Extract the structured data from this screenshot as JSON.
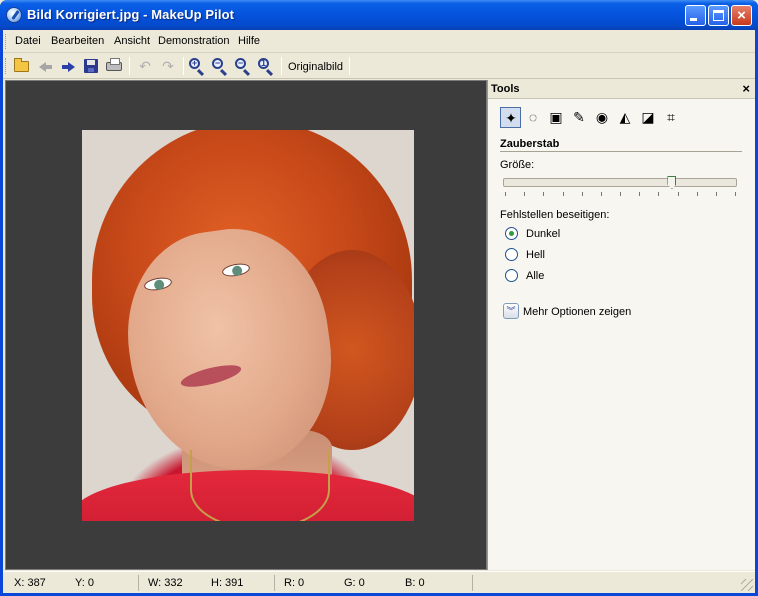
{
  "window": {
    "title": "Bild Korrigiert.jpg - MakeUp Pilot",
    "app_icon": "makeup-pilot-icon",
    "buttons": [
      "minimize",
      "maximize",
      "close"
    ]
  },
  "menu": {
    "items": [
      "Datei",
      "Bearbeiten",
      "Ansicht",
      "Demonstration",
      "Hilfe"
    ]
  },
  "toolbar": {
    "icons": [
      "open-folder-icon",
      "back-arrow-icon",
      "forward-arrow-icon",
      "save-icon",
      "print-icon",
      "undo-icon",
      "redo-icon",
      "zoom-in-icon",
      "zoom-out-icon",
      "zoom-fit-icon",
      "zoom-actual-icon"
    ],
    "zoom_in_sign": "+",
    "zoom_out_sign": "−",
    "zoom_fit_sign": "−",
    "zoom_actual_sign": "1",
    "undo_glyph": "↶",
    "redo_glyph": "↷",
    "original_label": "Originalbild"
  },
  "panel": {
    "title": "Tools",
    "close_glyph": "×",
    "tools": [
      {
        "name": "magic-wand",
        "glyph": "✦",
        "active": true
      },
      {
        "name": "lasso",
        "glyph": "◌",
        "active": false
      },
      {
        "name": "portrait",
        "glyph": "▣",
        "active": false
      },
      {
        "name": "brush",
        "glyph": "✎",
        "active": false
      },
      {
        "name": "eye",
        "glyph": "◉",
        "active": false
      },
      {
        "name": "color-triangle",
        "glyph": "◭",
        "active": false
      },
      {
        "name": "contrast",
        "glyph": "◪",
        "active": false
      },
      {
        "name": "crop",
        "glyph": "⌗",
        "active": false
      }
    ],
    "section_title": "Zauberstab",
    "size_label": "Größe:",
    "size_slider_value": 0.72,
    "defects_label": "Fehlstellen beseitigen:",
    "radio_options": [
      {
        "label": "Dunkel",
        "checked": true
      },
      {
        "label": "Hell",
        "checked": false
      },
      {
        "label": "Alle",
        "checked": false
      }
    ],
    "more_options_glyph": "︾",
    "more_options_label": "Mehr Optionen zeigen"
  },
  "status": {
    "x": "X: 387",
    "y": "Y: 0",
    "w": "W: 332",
    "h": "H: 391",
    "r": "R: 0",
    "g": "G: 0",
    "b": "B: 0"
  },
  "colors": {
    "titlebar": "#0553dd",
    "canvas_bg": "#3c3c3c",
    "panel_bg": "#f7f6f1",
    "radio_checked": "#2e9b3c"
  }
}
